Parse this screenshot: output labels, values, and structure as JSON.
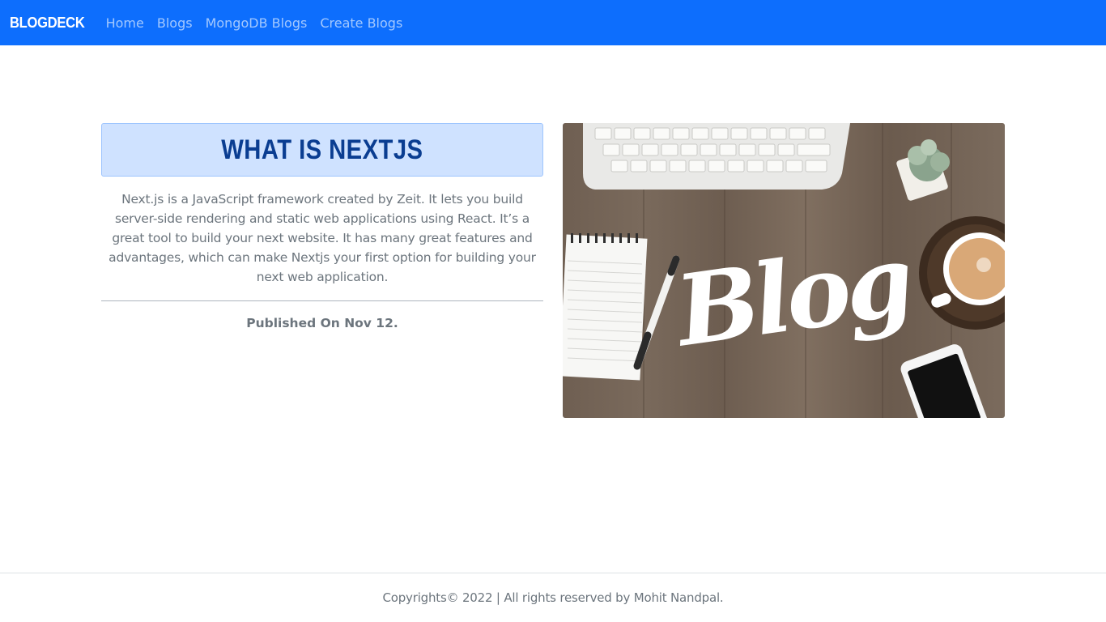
{
  "navbar": {
    "brand": "BLOGDECK",
    "links": [
      "Home",
      "Blogs",
      "MongoDB Blogs",
      "Create Blogs"
    ],
    "background": "#0d6efd"
  },
  "article": {
    "title": "WHAT IS NEXTJS",
    "description": "Next.js is a JavaScript framework created by Zeit. It lets you build server-side rendering and static web applications using React. It’s a great tool to build your next website. It has many great features and advantages, which can make Nextjs your first option for building your next web application.",
    "published": "Published On Nov 12.",
    "image_text": "Blog"
  },
  "footer": {
    "text": "Copyrights© 2022 | All rights reserved by Mohit Nandpal."
  },
  "colors": {
    "accent": "#0d6efd",
    "title_bg": "#cfe2ff",
    "title_text": "#0a3d91",
    "muted_text": "#6c757d"
  }
}
